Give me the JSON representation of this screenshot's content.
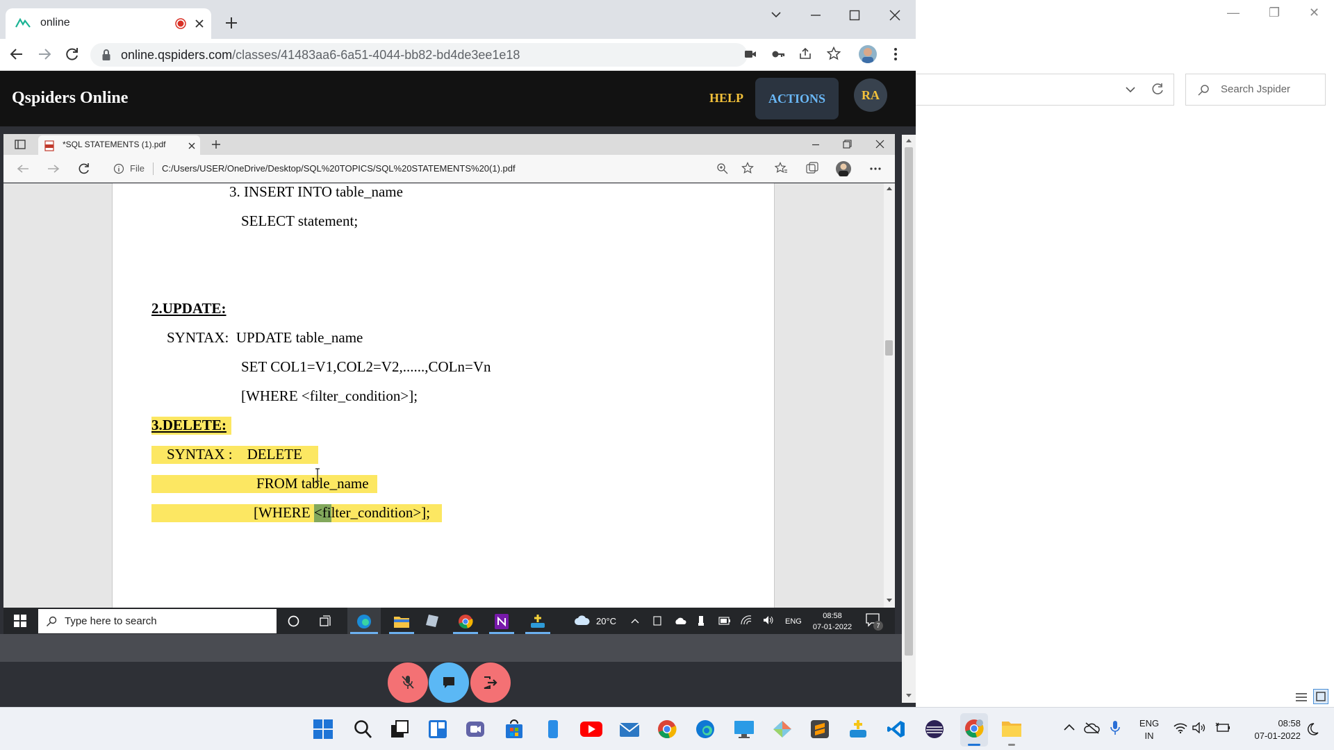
{
  "browser": {
    "tab_title": "online",
    "url_host": "online.qspiders.com",
    "url_path": "/classes/41483aa6-6a51-4044-bb82-bd4de3ee1e18"
  },
  "site": {
    "brand": "Qspiders Online",
    "help_label": "HELP",
    "actions_label": "ACTIONS",
    "avatar_initials": "RA"
  },
  "background_window": {
    "search_placeholder": "Search Jspider"
  },
  "shared_screen": {
    "edge_tab_title": "*SQL STATEMENTS (1).pdf",
    "file_label": "File",
    "file_path": "C:/Users/USER/OneDrive/Desktop/SQL%20TOPICS/SQL%20STATEMENTS%20(1).pdf",
    "doc_lines": {
      "insert_heading": "3. INSERT INTO table_name",
      "insert_select": "SELECT statement;",
      "update_heading": "2.UPDATE:",
      "update_syntax": "SYNTAX:  UPDATE table_name",
      "update_set": "SET COL1=V1,COL2=V2,......,COLn=Vn",
      "update_where": "[WHERE <filter_condition>];",
      "delete_heading": "3.DELETE:",
      "delete_syntax": "SYNTAX :    DELETE",
      "delete_from": "FROM table_name",
      "delete_where_a": "[WHERE ",
      "delete_where_b": "<",
      "delete_where_c": "filter_condition>];"
    },
    "taskbar": {
      "search_placeholder": "Type here to search",
      "temperature": "20°C",
      "language": "ENG",
      "time": "08:58",
      "date": "07-01-2022",
      "notification_count": "7"
    }
  },
  "taskbar": {
    "language": "ENG",
    "region": "IN",
    "time": "08:58",
    "date": "07-01-2022"
  },
  "colors": {
    "site_header": "#121212",
    "brand_help": "#f3c13a",
    "actions_text": "#6ab8f7",
    "highlight": "#fce762",
    "control_red": "#f47174",
    "control_blue": "#5bb8f5"
  }
}
